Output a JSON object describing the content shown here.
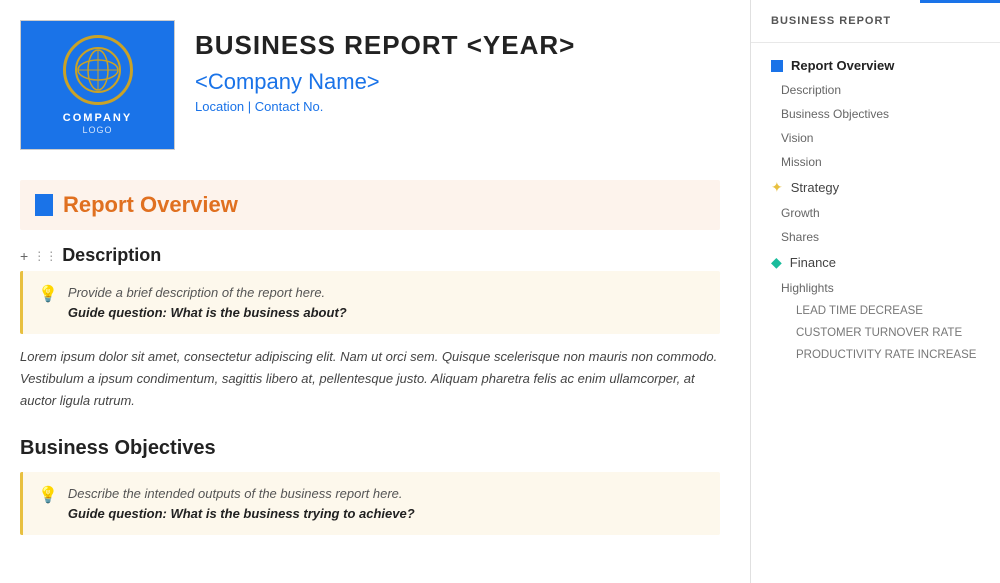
{
  "header": {
    "report_title": "BUSINESS REPORT <YEAR>",
    "company_name": "<Company Name>",
    "company_info": "Location | Contact No.",
    "logo_company": "COMPANY",
    "logo_sub": "LOGO"
  },
  "report_overview": {
    "section_label": "Report Overview",
    "description_heading": "Description",
    "hint_line1": "Provide a brief description of the report here.",
    "hint_line2": "Guide question: What is the business about?",
    "body_text": "Lorem ipsum dolor sit amet, consectetur adipiscing elit. Nam ut orci sem. Quisque scelerisque non mauris non commodo. Vestibulum a ipsum condimentum, sagittis libero at, pellentesque justo. Aliquam pharetra felis ac enim ullamcorper, at auctor ligula rutrum.",
    "objectives_heading": "Business Objectives",
    "objectives_hint_line1": "Describe the intended outputs of the business report here.",
    "objectives_hint_line2": "Guide question: What is the business trying to achieve?"
  },
  "sidebar": {
    "title": "BUSINESS REPORT",
    "items": [
      {
        "label": "Report Overview",
        "type": "parent",
        "icon": "square"
      },
      {
        "label": "Description",
        "type": "sub"
      },
      {
        "label": "Business Objectives",
        "type": "sub"
      },
      {
        "label": "Vision",
        "type": "sub"
      },
      {
        "label": "Mission",
        "type": "sub"
      },
      {
        "label": "Strategy",
        "type": "parent",
        "icon": "star"
      },
      {
        "label": "Growth",
        "type": "sub"
      },
      {
        "label": "Shares",
        "type": "sub"
      },
      {
        "label": "Finance",
        "type": "parent",
        "icon": "diamond"
      },
      {
        "label": "Highlights",
        "type": "sub"
      },
      {
        "label": "LEAD TIME DECREASE",
        "type": "deep"
      },
      {
        "label": "CUSTOMER TURNOVER RATE",
        "type": "deep"
      },
      {
        "label": "PRODUCTIVITY RATE INCREASE",
        "type": "deep"
      }
    ]
  }
}
